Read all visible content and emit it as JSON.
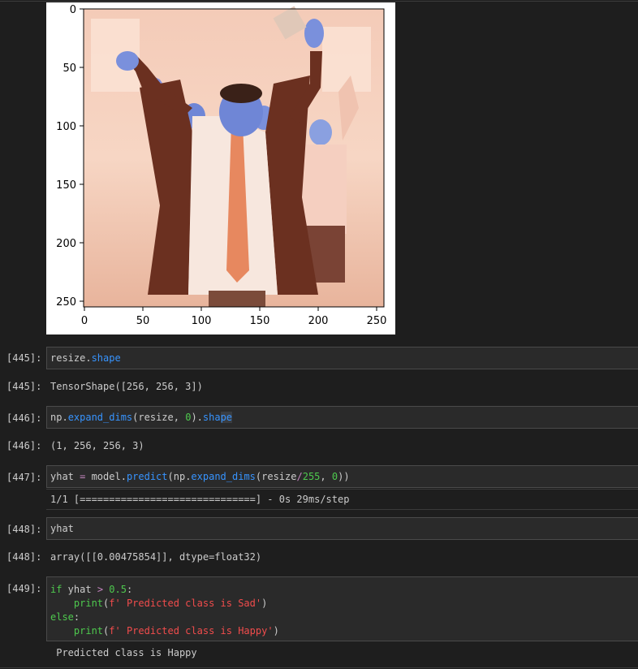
{
  "figure": {
    "x_ticks": [
      "0",
      "50",
      "100",
      "150",
      "200",
      "250"
    ],
    "y_ticks": [
      "0",
      "50",
      "100",
      "150",
      "200",
      "250"
    ],
    "image_description_icon": "photo-image-icon"
  },
  "cells": {
    "c445": {
      "in_prompt": "[445]:",
      "code_obj": "resize.",
      "code_attr": "shape",
      "out_prompt": "[445]:",
      "output": "TensorShape([256, 256, 3])"
    },
    "c446": {
      "in_prompt": "[446]:",
      "code_np": "np.",
      "code_fn": "expand_dims",
      "code_args1": "(resize, ",
      "code_zero": "0",
      "code_args2": ").",
      "code_sh": "sha",
      "code_pe": "pe",
      "out_prompt": "[446]:",
      "output": "(1, 256, 256, 3)"
    },
    "c447": {
      "in_prompt": "[447]:",
      "code_a": "yhat ",
      "code_eq": "=",
      "code_b": " model.",
      "code_predict": "predict",
      "code_c": "(np.",
      "code_fn": "expand_dims",
      "code_d": "(resize",
      "code_div": "/",
      "code_255": "255",
      "code_e": ", ",
      "code_zero": "0",
      "code_f": "))",
      "stream": "1/1 [==============================] - 0s 29ms/step"
    },
    "c448": {
      "in_prompt": "[448]:",
      "code": "yhat",
      "out_prompt": "[448]:",
      "output": "array([[0.00475854]], dtype=float32)"
    },
    "c449": {
      "in_prompt": "[449]:",
      "l1_if": "if",
      "l1_a": " yhat ",
      "l1_gt": ">",
      "l1_sp": " ",
      "l1_num": "0.5",
      "l1_colon": ":",
      "l2_indent": "    ",
      "l2_print": "print",
      "l2_open": "(",
      "l2_str": "f' Predicted class is Sad'",
      "l2_close": ")",
      "l3_else": "else",
      "l3_colon": ":",
      "l4_indent": "    ",
      "l4_print": "print",
      "l4_open": "(",
      "l4_str": "f' Predicted class is Happy'",
      "l4_close": ")",
      "output": " Predicted class is Happy"
    }
  },
  "colors": {
    "background": "#1e1e1e",
    "cell_bg": "#2a2a2a",
    "attr_blue": "#3794ff",
    "number_green": "#4ec94e",
    "string_red": "#f14c4c",
    "keyword_purple": "#c586c0"
  }
}
